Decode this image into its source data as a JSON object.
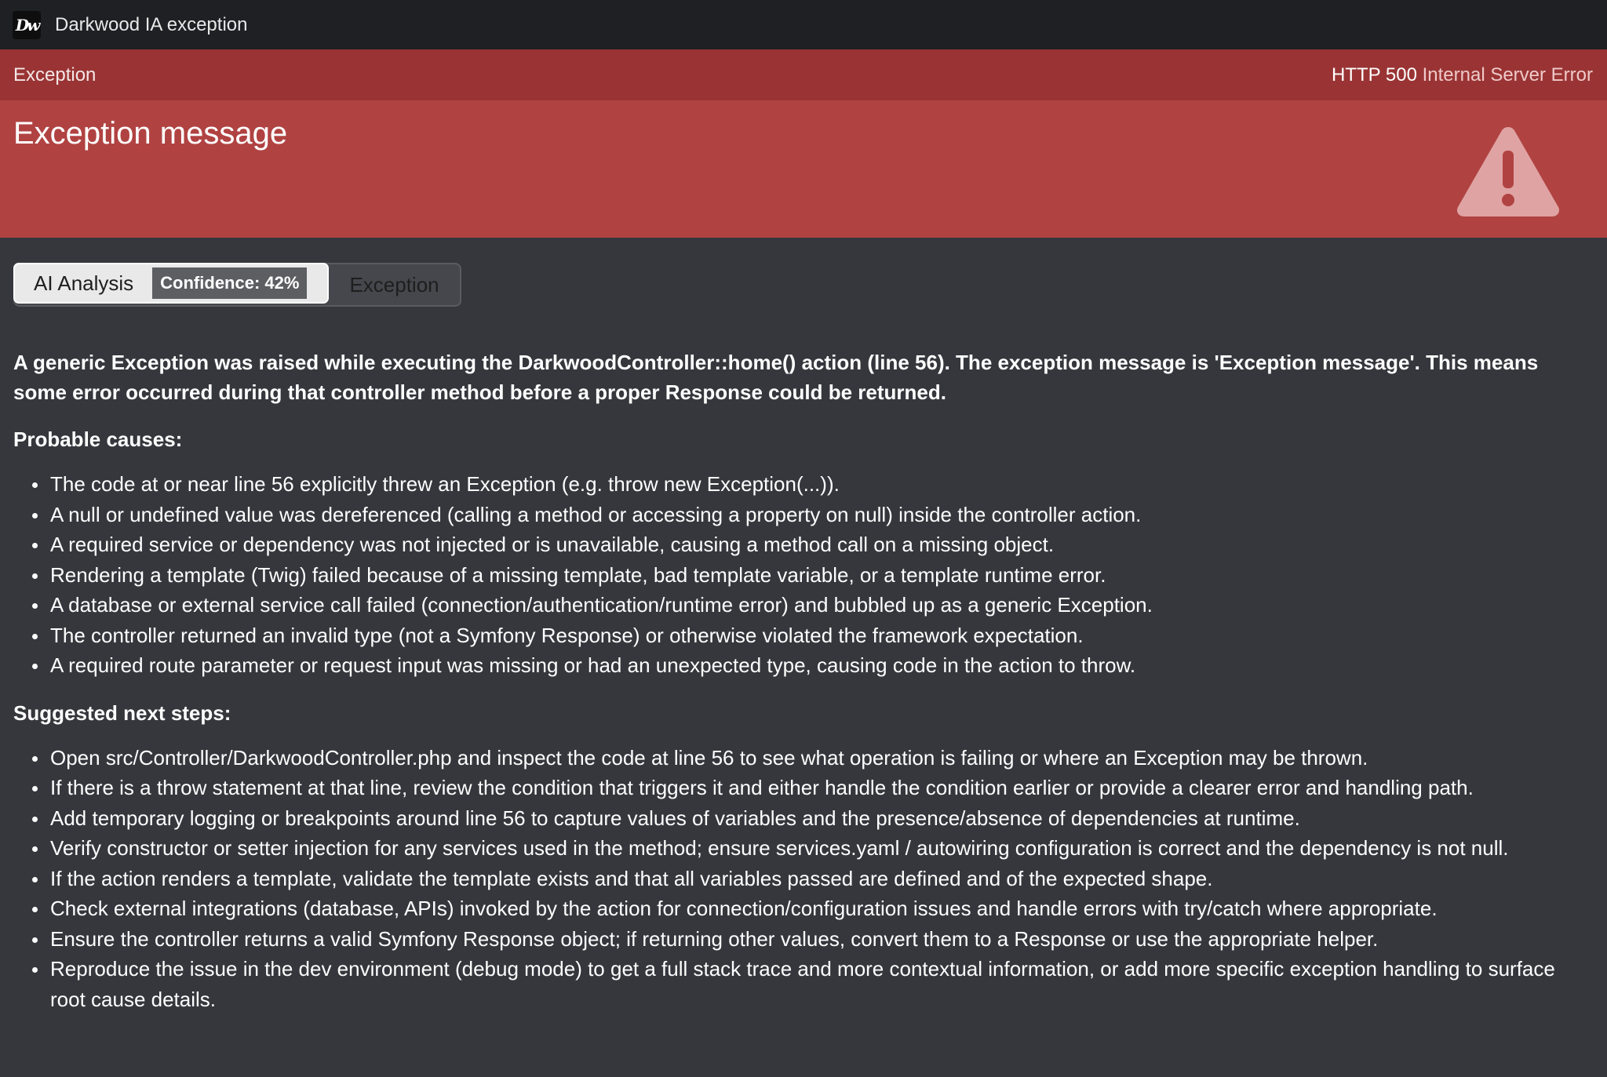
{
  "app": {
    "logo_text": "Dw",
    "title": "Darkwood IA exception"
  },
  "exception": {
    "class_name": "Exception",
    "http_code": "HTTP 500",
    "http_text": "Internal Server Error",
    "message": "Exception message",
    "icon": "warning-triangle-icon"
  },
  "tabs": {
    "ai_label": "AI Analysis",
    "confidence_label": "Confidence: 42%",
    "exception_label": "Exception"
  },
  "analysis": {
    "summary": "A generic Exception was raised while executing the DarkwoodController::home() action (line 56). The exception message is 'Exception message'. This means some error occurred during that controller method before a proper Response could be returned.",
    "causes_title": "Probable causes:",
    "causes": [
      "The code at or near line 56 explicitly threw an Exception (e.g. throw new Exception(...)).",
      "A null or undefined value was dereferenced (calling a method or accessing a property on null) inside the controller action.",
      "A required service or dependency was not injected or is unavailable, causing a method call on a missing object.",
      "Rendering a template (Twig) failed because of a missing template, bad template variable, or a template runtime error.",
      "A database or external service call failed (connection/authentication/runtime error) and bubbled up as a generic Exception.",
      "The controller returned an invalid type (not a Symfony Response) or otherwise violated the framework expectation.",
      "A required route parameter or request input was missing or had an unexpected type, causing code in the action to throw."
    ],
    "steps_title": "Suggested next steps:",
    "steps": [
      "Open src/Controller/DarkwoodController.php and inspect the code at line 56 to see what operation is failing or where an Exception may be thrown.",
      "If there is a throw statement at that line, review the condition that triggers it and either handle the condition earlier or provide a clearer error and handling path.",
      "Add temporary logging or breakpoints around line 56 to capture values of variables and the presence/absence of dependencies at runtime.",
      "Verify constructor or setter injection for any services used in the method; ensure services.yaml / autowiring configuration is correct and the dependency is not null.",
      "If the action renders a template, validate the template exists and that all variables passed are defined and of the expected shape.",
      "Check external integrations (database, APIs) invoked by the action for connection/configuration issues and handle errors with try/catch where appropriate.",
      "Ensure the controller returns a valid Symfony Response object; if returning other values, convert them to a Response or use the appropriate helper.",
      "Reproduce the issue in the dev environment (debug mode) to get a full stack trace and more contextual information, or add more specific exception handling to surface root cause details."
    ]
  },
  "colors": {
    "topbar": "#1f2023",
    "exception_bar": "#9a3434",
    "exception_main": "#b04342",
    "page_bg": "#36373d"
  }
}
